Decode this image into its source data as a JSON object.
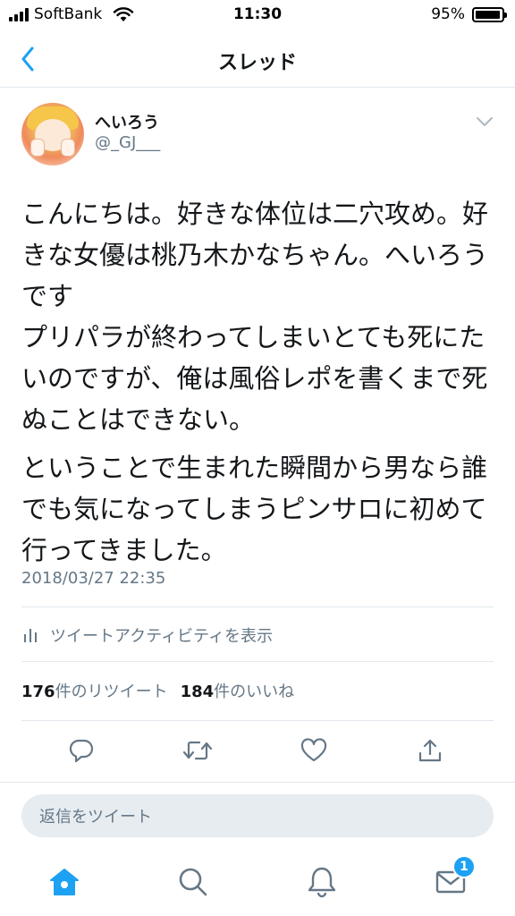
{
  "status_bar": {
    "carrier": "SoftBank",
    "time": "11:30",
    "battery_percent_text": "95%",
    "battery_level": 0.95
  },
  "header": {
    "title": "スレッド",
    "back_icon": "chevron-left-icon"
  },
  "tweet": {
    "author": {
      "display_name": "へいろう",
      "handle": "@_GJ___"
    },
    "paragraphs": [
      "こんにちは。好きな体位は二穴攻め。好きな女優は桃乃木かなちゃん。へいろうです\nプリパラが終わってしまいとても死にたいのですが、俺は風俗レポを書くまで死ぬことはできない。",
      "ということで生まれた瞬間から男なら誰でも気になってしまうピンサロに初めて行ってきました。"
    ],
    "timestamp": "2018/03/27 22:35",
    "activity_label": "ツイートアクティビティを表示",
    "stats": {
      "retweet_count": "176",
      "retweet_label": "件のリツイート",
      "like_count": "184",
      "like_label": "件のいいね"
    }
  },
  "actions": [
    "reply-icon",
    "retweet-icon",
    "like-icon",
    "share-icon"
  ],
  "reply_box": {
    "placeholder": "返信をツイート"
  },
  "tabbar": {
    "items": [
      "home-icon",
      "search-icon",
      "notifications-icon",
      "messages-icon"
    ],
    "messages_badge": "1"
  },
  "colors": {
    "accent": "#1da1f2",
    "secondary_text": "#657786",
    "divider": "#e1e8ed"
  }
}
